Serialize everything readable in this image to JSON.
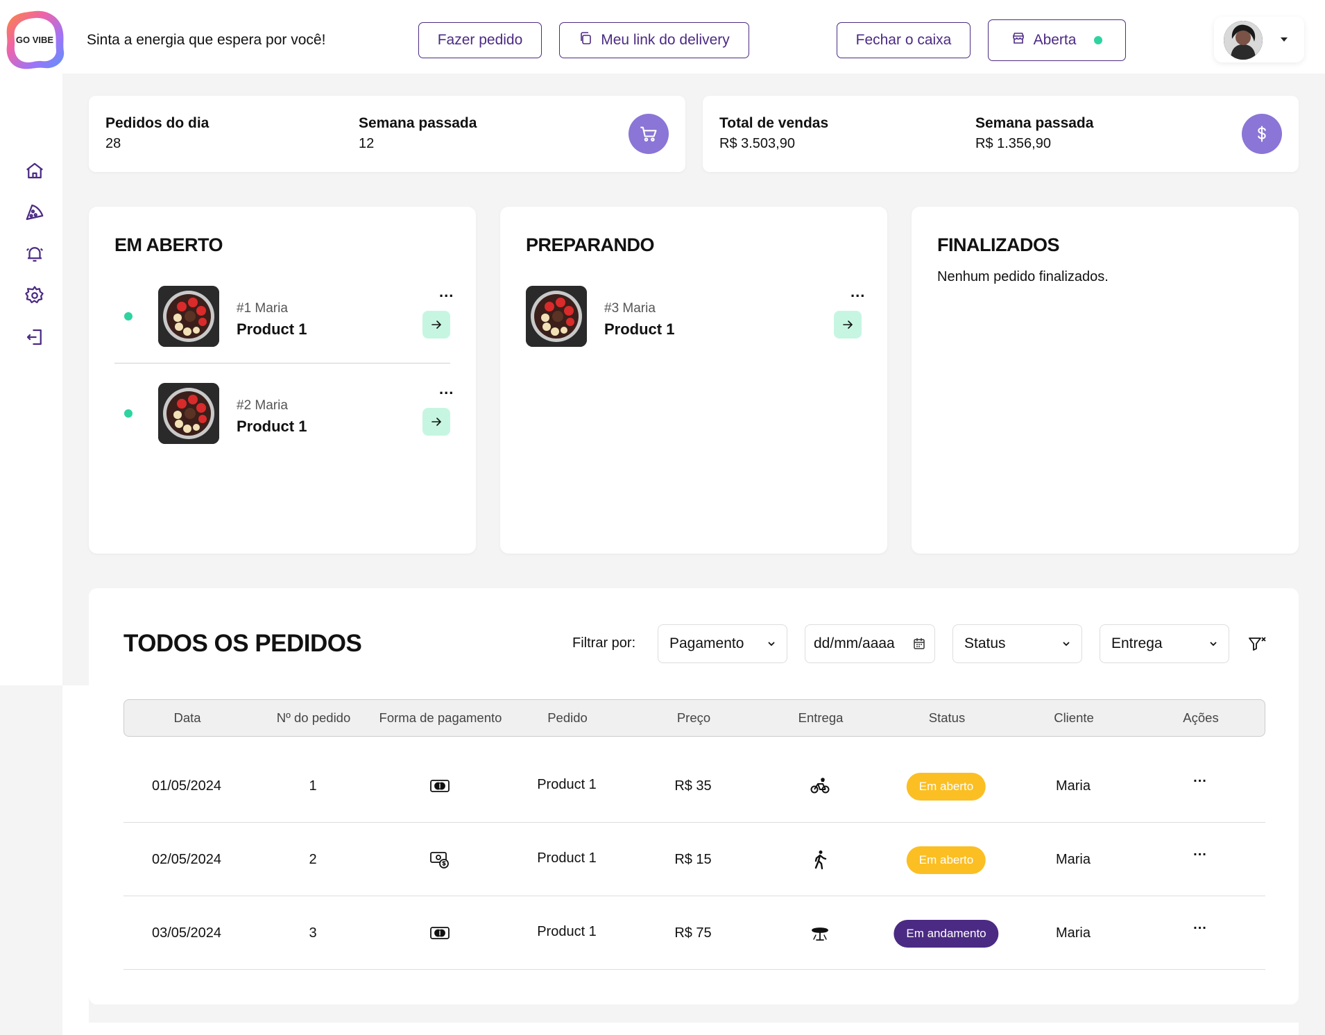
{
  "header": {
    "brand": "GO VIBE",
    "tagline": "Sinta a energia que espera por você!",
    "buttons": {
      "order": "Fazer pedido",
      "delivery_link": "Meu link do delivery",
      "close_register": "Fechar o caixa",
      "store_status": "Aberta"
    },
    "colors": {
      "accent": "#4b2a83",
      "online": "#2dd4a0"
    }
  },
  "sidebar": {
    "items": [
      {
        "icon": "home-icon"
      },
      {
        "icon": "pizza-icon"
      },
      {
        "icon": "bell-icon"
      },
      {
        "icon": "gear-icon"
      },
      {
        "icon": "logout-icon"
      }
    ]
  },
  "stats": [
    {
      "label_left": "Pedidos do dia",
      "value_left": "28",
      "label_right": "Semana passada",
      "value_right": "12",
      "icon": "cart-icon"
    },
    {
      "label_left": "Total de vendas",
      "value_left": "R$ 3.503,90",
      "label_right": "Semana passada",
      "value_right": "R$ 1.356,90",
      "icon": "dollar-icon"
    }
  ],
  "kanban": {
    "open": {
      "title": "EM ABERTO",
      "cards": [
        {
          "order": "#1 Maria",
          "product": "Product 1",
          "menu": "..."
        },
        {
          "order": "#2 Maria",
          "product": "Product 1",
          "menu": "..."
        }
      ]
    },
    "preparing": {
      "title": "PREPARANDO",
      "cards": [
        {
          "order": "#3 Maria",
          "product": "Product 1",
          "menu": "..."
        }
      ]
    },
    "done": {
      "title": "FINALIZADOS",
      "empty": "Nenhum pedido finalizados."
    }
  },
  "orders": {
    "title": "TODOS OS PEDIDOS",
    "filter_label": "Filtrar por:",
    "filters": {
      "payment": "Pagamento",
      "date_placeholder": "dd/mm/aaaa",
      "status": "Status",
      "delivery": "Entrega"
    },
    "columns": [
      "Data",
      "Nº do pedido",
      "Forma de pagamento",
      "Pedido",
      "Preço",
      "Entrega",
      "Status",
      "Cliente",
      "Ações"
    ],
    "rows": [
      {
        "date": "01/05/2024",
        "number": "1",
        "payment_icon": "card-icon",
        "product": "Product 1",
        "price": "R$ 35",
        "delivery_icon": "bike-icon",
        "status": "Em aberto",
        "status_color": "#fbbf24",
        "client": "Maria",
        "actions": "..."
      },
      {
        "date": "02/05/2024",
        "number": "2",
        "payment_icon": "cash-icon",
        "product": "Product 1",
        "price": "R$ 15",
        "delivery_icon": "walk-icon",
        "status": "Em aberto",
        "status_color": "#fbbf24",
        "client": "Maria",
        "actions": "..."
      },
      {
        "date": "03/05/2024",
        "number": "3",
        "payment_icon": "card-icon",
        "product": "Product 1",
        "price": "R$ 75",
        "delivery_icon": "table-icon",
        "status": "Em andamento",
        "status_color": "#4b2a83",
        "client": "Maria",
        "actions": "..."
      }
    ]
  }
}
